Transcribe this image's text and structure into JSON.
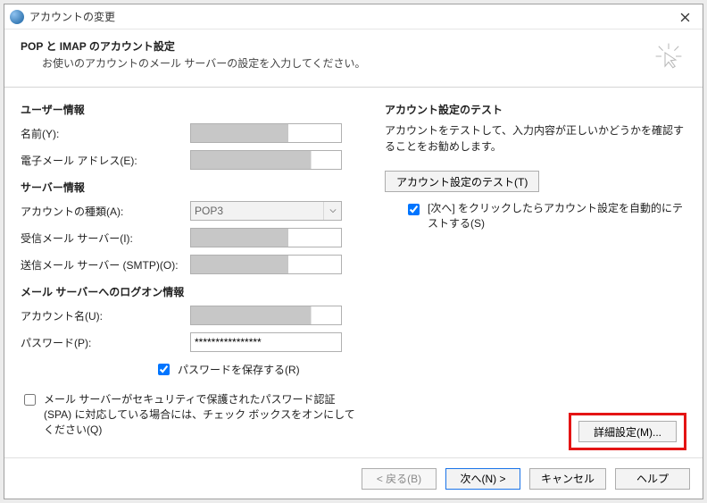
{
  "titlebar": {
    "title": "アカウントの変更"
  },
  "header": {
    "title": "POP と IMAP のアカウント設定",
    "subtitle": "お使いのアカウントのメール サーバーの設定を入力してください。"
  },
  "left": {
    "user_section": "ユーザー情報",
    "name_label": "名前(Y):",
    "email_label": "電子メール アドレス(E):",
    "server_section": "サーバー情報",
    "account_type_label": "アカウントの種類(A):",
    "account_type_value": "POP3",
    "incoming_label": "受信メール サーバー(I):",
    "outgoing_label": "送信メール サーバー (SMTP)(O):",
    "logon_section": "メール サーバーへのログオン情報",
    "account_name_label": "アカウント名(U):",
    "password_label": "パスワード(P):",
    "password_value": "****************",
    "save_password_label": "パスワードを保存する(R)",
    "spa_label": "メール サーバーがセキュリティで保護されたパスワード認証 (SPA) に対応している場合には、チェック ボックスをオンにしてください(Q)"
  },
  "right": {
    "test_section": "アカウント設定のテスト",
    "test_desc": "アカウントをテストして、入力内容が正しいかどうかを確認することをお勧めします。",
    "test_button": "アカウント設定のテスト(T)",
    "auto_test_label": "[次へ] をクリックしたらアカウント設定を自動的にテストする(S)",
    "advanced_button": "詳細設定(M)..."
  },
  "footer": {
    "back": "< 戻る(B)",
    "next": "次へ(N) >",
    "cancel": "キャンセル",
    "help": "ヘルプ"
  }
}
